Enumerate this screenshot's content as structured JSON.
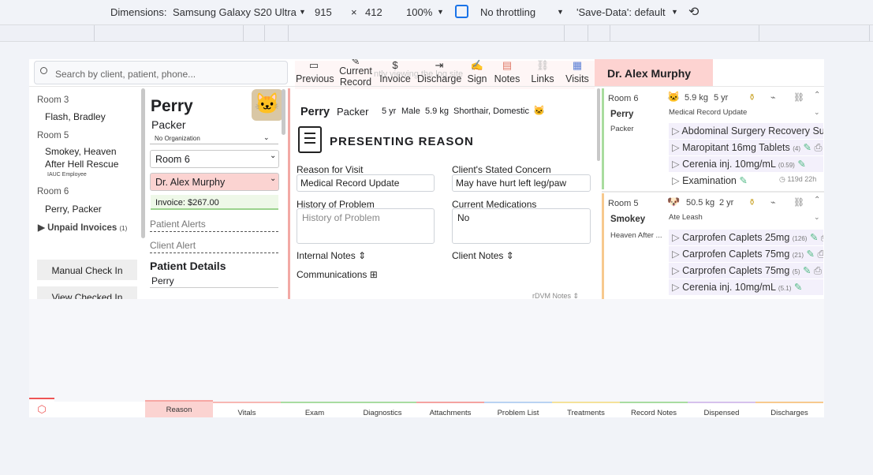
{
  "devtools": {
    "dimensions_label": "Dimensions:",
    "device": "Samsung Galaxy S20 Ultra",
    "width": "915",
    "times": "×",
    "height": "412",
    "zoom": "100%",
    "throttling": "No throttling",
    "save_data": "'Save-Data': default"
  },
  "search": {
    "placeholder": "Search by client, patient, phone..."
  },
  "toolbar": {
    "previous": "Previous",
    "current_1": "Current",
    "current_2": "Record",
    "invoice": "Invoice",
    "discharge": "Discharge",
    "sign": "Sign",
    "notes": "Notes",
    "links": "Links",
    "visits": "Visits",
    "ghost_text": "ntly viewing the log site"
  },
  "doctor_header": "Dr. Alex Murphy",
  "rooms": [
    {
      "room": "Room 3",
      "entries": [
        "Flash, Bradley"
      ]
    },
    {
      "room": "Room 5",
      "entries": [
        "Smokey, Heaven",
        "After Hell Rescue"
      ],
      "note": "IAUC Employee"
    },
    {
      "room": "Room 6",
      "entries": [
        "Perry, Packer"
      ]
    }
  ],
  "unpaid": {
    "label": "Unpaid Invoices",
    "count": "(1)"
  },
  "buttons": {
    "manual_checkin": "Manual Check In",
    "view_checked_in": "View Checked In"
  },
  "patient": {
    "name": "Perry",
    "last": "Packer",
    "organization": "No Organization",
    "room": "Room 6",
    "doctor": "Dr. Alex Murphy",
    "invoice": "Invoice: $267.00",
    "patient_alerts": "Patient Alerts",
    "client_alert": "Client Alert",
    "details_title": "Patient Details",
    "details_name": "Perry"
  },
  "summary": {
    "name": "Perry",
    "last": "Packer",
    "age": "5 yr",
    "sex": "Male",
    "weight": "5.9 kg",
    "breed": "Shorthair, Domestic"
  },
  "reason": {
    "title": "PRESENTING REASON",
    "reason_label": "Reason for Visit",
    "reason_value": "Medical Record Update",
    "concern_label": "Client's Stated Concern",
    "concern_value": "May have hurt left leg/paw",
    "history_label": "History of Problem",
    "history_placeholder": "History of Problem",
    "meds_label": "Current Medications",
    "meds_value": "No",
    "internal_notes": "Internal Notes",
    "client_notes": "Client Notes",
    "communications": "Communications",
    "rdvm_notes": "rDVM Notes"
  },
  "cards": [
    {
      "room": "Room 6",
      "weight": "5.9 kg",
      "age": "5 yr",
      "name": "Perry",
      "reason": "Medical Record Update",
      "last": "Packer",
      "items": [
        {
          "label": "Abdominal Surgery Recovery Suit",
          "qty": ""
        },
        {
          "label": "Maropitant 16mg Tablets",
          "qty": "(4)"
        },
        {
          "label": "Cerenia inj. 10mg/mL",
          "qty": "(0.59)"
        },
        {
          "label": "Examination",
          "qty": ""
        }
      ],
      "time": "119d 22h"
    },
    {
      "room": "Room 5",
      "weight": "50.5 kg",
      "age": "2 yr",
      "name": "Smokey",
      "reason": "Ate Leash",
      "last": "Heaven After ...",
      "items": [
        {
          "label": "Carprofen Caplets 25mg",
          "qty": "(126)"
        },
        {
          "label": "Carprofen Caplets 75mg",
          "qty": "(21)"
        },
        {
          "label": "Carprofen Caplets 75mg",
          "qty": "(5)"
        },
        {
          "label": "Cerenia inj. 10mg/mL",
          "qty": "(5.1)"
        }
      ]
    }
  ],
  "tabs": [
    {
      "label": "Reason",
      "color": "#f7a7a3"
    },
    {
      "label": "Vitals",
      "color": "#f7b7b3"
    },
    {
      "label": "Exam",
      "color": "#a8dca0"
    },
    {
      "label": "Diagnostics",
      "color": "#a8dca0"
    },
    {
      "label": "Attachments",
      "color": "#f4a3a0"
    },
    {
      "label": "Problem List",
      "color": "#b9d3f2"
    },
    {
      "label": "Treatments",
      "color": "#f4e29a"
    },
    {
      "label": "Record Notes",
      "color": "#a8dca0"
    },
    {
      "label": "Dispensed",
      "color": "#d6c1ec"
    },
    {
      "label": "Discharges",
      "color": "#f7c98e"
    }
  ]
}
